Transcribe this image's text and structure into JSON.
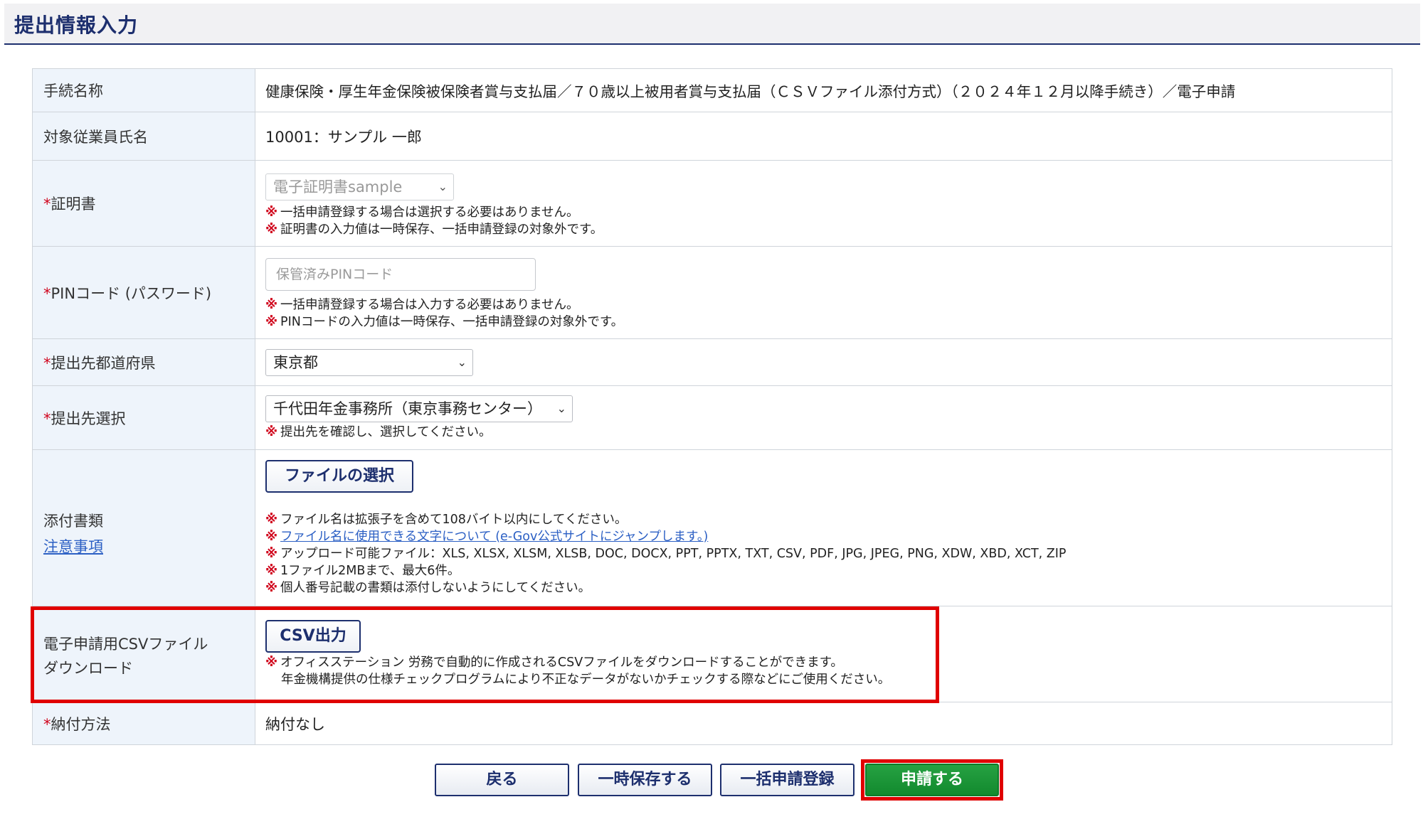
{
  "header": {
    "title": "提出情報入力"
  },
  "required_mark": "*",
  "note_mark": "※",
  "rows": {
    "procedure": {
      "label": "手続名称",
      "value": "健康保険・厚生年金保険被保険者賞与支払届／７０歳以上被用者賞与支払届（ＣＳＶファイル添付方式）（２０２４年１２月以降手続き）／電子申請"
    },
    "employee": {
      "label": "対象従業員氏名",
      "value": "10001：サンプル 一郎"
    },
    "certificate": {
      "label": "証明書",
      "selected": "電子証明書sample",
      "notes": [
        "一括申請登録する場合は選択する必要はありません。",
        "証明書の入力値は一時保存、一括申請登録の対象外です。"
      ]
    },
    "pin": {
      "label": "PINコード (パスワード)",
      "placeholder": "保管済みPINコード",
      "notes": [
        "一括申請登録する場合は入力する必要はありません。",
        "PINコードの入力値は一時保存、一括申請登録の対象外です。"
      ]
    },
    "prefecture": {
      "label": "提出先都道府県",
      "selected": "東京都"
    },
    "destination": {
      "label": "提出先選択",
      "selected": "千代田年金事務所（東京事務センター）",
      "notes": [
        "提出先を確認し、選択してください。"
      ]
    },
    "attachment": {
      "label": "添付書類",
      "caution_link": "注意事項",
      "button": "ファイルの選択",
      "notes": [
        "ファイル名は拡張子を含めて108バイト以内にしてください。",
        "ファイル名に使用できる文字について (e-Gov公式サイトにジャンプします。)",
        "アップロード可能ファイル：XLS, XLSX, XLSM, XLSB, DOC, DOCX, PPT, PPTX, TXT, CSV, PDF, JPG, JPEG, PNG, XDW, XBD, XCT, ZIP",
        "1ファイル2MBまで、最大6件。",
        "個人番号記載の書類は添付しないようにしてください。"
      ]
    },
    "csv": {
      "label_line1": "電子申請用CSVファイル",
      "label_line2": "ダウンロード",
      "button": "CSV出力",
      "note_line1": "オフィスステーション 労務で自動的に作成されるCSVファイルをダウンロードすることができます。",
      "note_line2": "年金機構提供の仕様チェックプログラムにより不正なデータがないかチェックする際などにご使用ください。"
    },
    "payment": {
      "label": "納付方法",
      "value": "納付なし"
    }
  },
  "actions": {
    "back": "戻る",
    "temp_save": "一時保存する",
    "bulk_register": "一括申請登録",
    "submit": "申請する"
  },
  "colors": {
    "navy": "#1d2f6e",
    "highlight_red": "#e00000",
    "submit_green": "#1a952f",
    "label_bg": "#eef4fb"
  }
}
